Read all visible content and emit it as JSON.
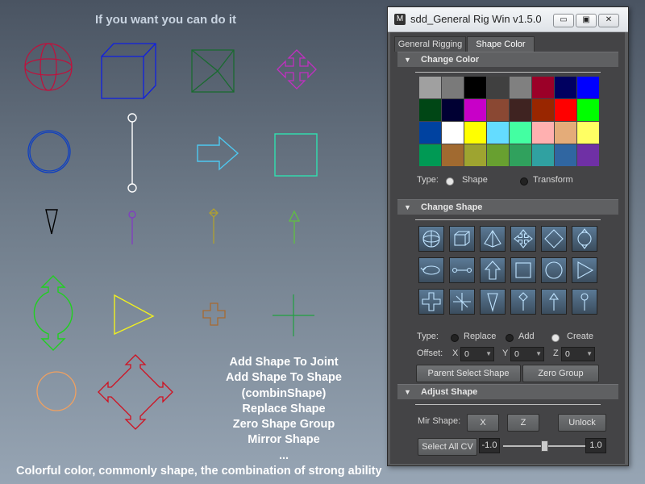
{
  "canvas": {
    "heading": "If you want you can do it",
    "features": [
      "Add Shape To Joint",
      "Add Shape To Shape",
      "(combinShape)",
      "Replace Shape",
      "Zero Shape Group",
      "Mirror Shape",
      "..."
    ],
    "tagline": "Colorful color, commonly  shape, the combination of strong ability",
    "shape_icons": [
      "sphere-curve-icon",
      "cube-curve-icon",
      "pyramid-curve-icon",
      "four-arrow-curve-icon",
      "circle-curve-icon",
      "pin-curve-icon",
      "arrow-curve-icon",
      "square-curve-icon",
      "triangle-pointer-curve-icon",
      "lollipop-curve-icon",
      "diamond-pin-curve-icon",
      "arrow-up-curve-icon",
      "double-arrow-circle-curve-icon",
      "triangle-curve-icon",
      "cross-curve-icon",
      "plus-thin-curve-icon",
      "circle-small-curve-icon",
      "four-arrow-diamond-curve-icon"
    ]
  },
  "window": {
    "title": "sdd_General Rig Win v1.5.0",
    "controls": {
      "minimize": "▭",
      "restore": "▣",
      "close": "✕"
    },
    "tabs": [
      {
        "label": "General Rigging",
        "active": false
      },
      {
        "label": "Shape Color",
        "active": true
      }
    ],
    "change_color": {
      "header": "Change Color",
      "colors": [
        [
          "#a0a0a0",
          "#7a7a7a",
          "#000000",
          "#404040",
          "#808080",
          "#9b0028",
          "#000060",
          "#0000ff"
        ],
        [
          "#004615",
          "#000033",
          "#c800c8",
          "#8a4833",
          "#3f2321",
          "#992600",
          "#ff0000",
          "#00ff00"
        ],
        [
          "#0042a0",
          "#ffffff",
          "#ffff00",
          "#64dcff",
          "#43ffa2",
          "#ffb0b0",
          "#e4ac79",
          "#ffff63"
        ],
        [
          "#009954",
          "#a16a30",
          "#9ea430",
          "#68a030",
          "#30a15d",
          "#30a1a1",
          "#3066a1",
          "#6f30a5"
        ]
      ],
      "type_label": "Type:",
      "type_options": [
        {
          "label": "Shape",
          "selected": true
        },
        {
          "label": "Transform",
          "selected": false
        }
      ]
    },
    "change_shape": {
      "header": "Change Shape",
      "buttons": [
        "sphere",
        "cube",
        "pyramid",
        "four-arrow",
        "diamond-arrows",
        "circle-arrows",
        "rotate-arrow",
        "line-circles",
        "up-arrow",
        "square",
        "circle",
        "play-triangle",
        "plus",
        "star-cross",
        "down-triangle",
        "pin-arrow",
        "up-pin",
        "lollipop"
      ],
      "type_label": "Type:",
      "type_options": [
        {
          "label": "Replace",
          "selected": false
        },
        {
          "label": "Add",
          "selected": false
        },
        {
          "label": "Create",
          "selected": true
        }
      ],
      "offset_label": "Offset:",
      "offsets": [
        {
          "axis": "X",
          "value": "0"
        },
        {
          "axis": "Y",
          "value": "0"
        },
        {
          "axis": "Z",
          "value": "0"
        }
      ],
      "parent_select_shape": "Parent Select Shape",
      "zero_group": "Zero Group"
    },
    "adjust_shape": {
      "header": "Adjust Shape",
      "mir_shape_label": "Mir Shape:",
      "x_button": "X",
      "z_button": "Z",
      "unlock_button": "Unlock",
      "select_all_cv": "Select All CV",
      "min_value": "-1.0",
      "max_value": "1.0",
      "slider_value": 0.5
    }
  }
}
